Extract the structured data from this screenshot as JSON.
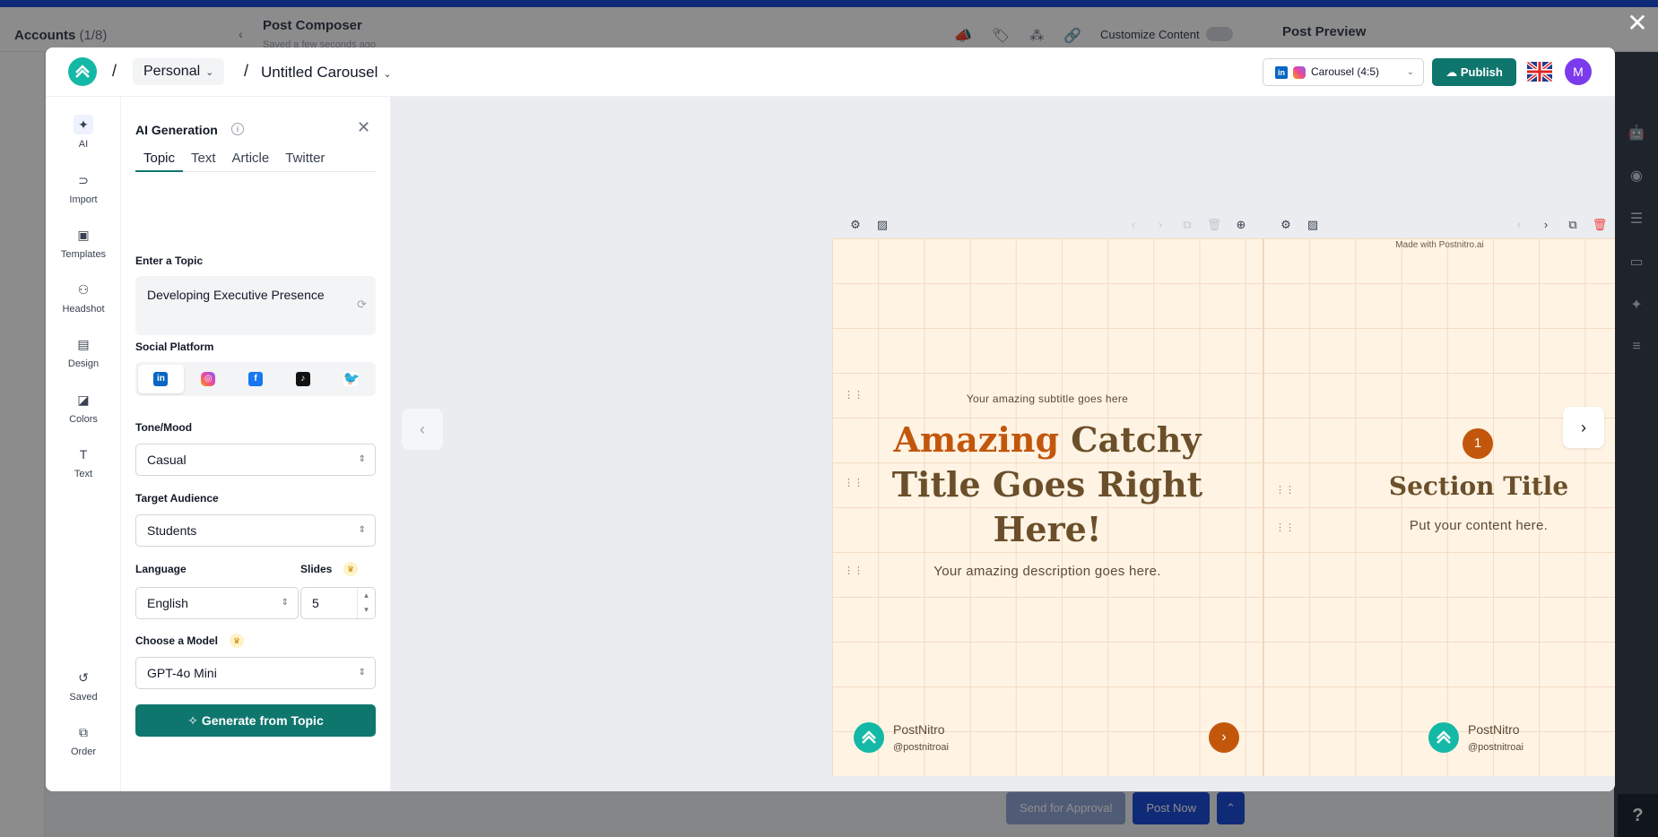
{
  "background": {
    "accounts_title": "Accounts",
    "accounts_count": "(1/8)",
    "composer_title": "Post Composer",
    "composer_sub": "Saved a few seconds ago",
    "customize_label": "Customize Content",
    "preview_title": "Post Preview",
    "send_approval_label": "Send for Approval",
    "post_now_label": "Post Now",
    "help_label": "?"
  },
  "header": {
    "workspace": "Personal",
    "title": "Untitled Carousel",
    "format": "Carousel (4:5)",
    "publish_label": "Publish",
    "avatar_initial": "M"
  },
  "rail": {
    "items": [
      {
        "label": "AI",
        "icon": "sparkle-icon"
      },
      {
        "label": "Import",
        "icon": "import-icon"
      },
      {
        "label": "Templates",
        "icon": "templates-icon"
      },
      {
        "label": "Headshot",
        "icon": "headshot-icon"
      },
      {
        "label": "Design",
        "icon": "design-icon"
      },
      {
        "label": "Colors",
        "icon": "colors-icon"
      },
      {
        "label": "Text",
        "icon": "text-icon"
      },
      {
        "label": "Saved",
        "icon": "history-icon"
      },
      {
        "label": "Order",
        "icon": "order-icon"
      }
    ]
  },
  "panel": {
    "title": "AI Generation",
    "tabs": [
      "Topic",
      "Text",
      "Article",
      "Twitter"
    ],
    "topic_label": "Enter a Topic",
    "topic_value": "Developing Executive Presence",
    "platform_label": "Social Platform",
    "tone_label": "Tone/Mood",
    "tone_value": "Casual",
    "audience_label": "Target Audience",
    "audience_value": "Students",
    "language_label": "Language",
    "language_value": "English",
    "slides_label": "Slides",
    "slides_value": "5",
    "model_label": "Choose a Model",
    "model_value": "GPT-4o Mini",
    "generate_label": "Generate from Topic"
  },
  "slide1": {
    "subtitle": "Your amazing subtitle goes here",
    "title_highlight": "Amazing",
    "title_rest": " Catchy Title Goes Right Here!",
    "description": "Your amazing description goes here.",
    "brand_name": "PostNitro",
    "brand_handle": "@postnitroai"
  },
  "slide2": {
    "made_with": "Made with Postnitro.ai",
    "number": "1",
    "title": "Section Title",
    "body": "Put your content here.",
    "brand_name": "PostNitro",
    "brand_handle": "@postnitroai"
  },
  "colors": {
    "accent": "#0f766e",
    "slide_bg": "#fff3e4",
    "slide_accent": "#c2570c",
    "slide_text": "#6b4f2a"
  }
}
